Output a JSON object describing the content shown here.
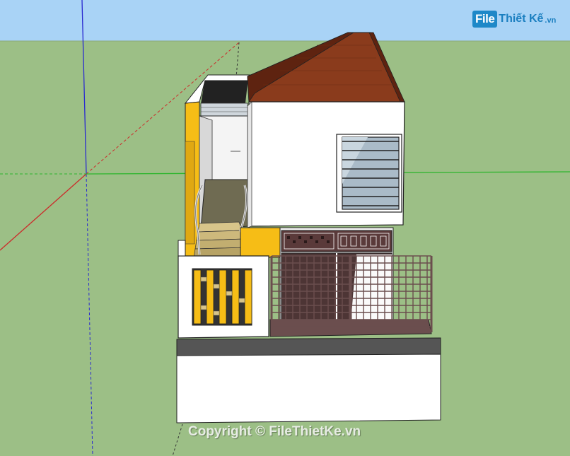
{
  "app": {
    "viewport": "3d-model-viewport"
  },
  "colors": {
    "sky": "#a9d3f6",
    "ground": "#9cbf86",
    "wall_white": "#ffffff",
    "wall_yellow": "#f6bd16",
    "roof": "#8a3b1c",
    "roof_edge": "#5e2310",
    "slab_dark": "#555555",
    "fence": "#6b4e4e",
    "axis_red": "#cc2a2a",
    "axis_green": "#2db52d",
    "axis_blue": "#2a2ad0",
    "logo_blue": "#1e88c8"
  },
  "watermark": {
    "logo_file": "File",
    "logo_rest": "Thiết Kế",
    "logo_tld": ".vn",
    "copyright": "Copyright © FileThietKe.vn"
  }
}
